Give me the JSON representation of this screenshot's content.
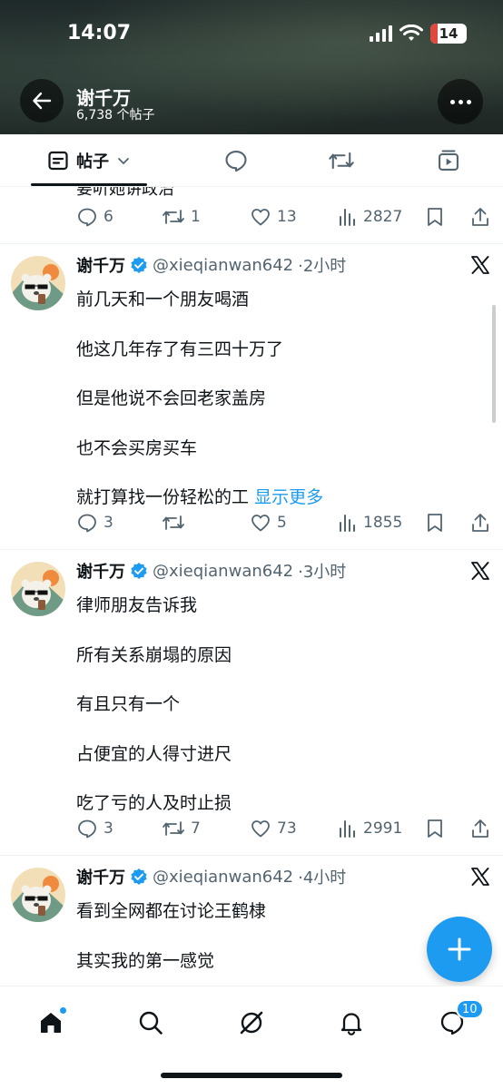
{
  "status_bar": {
    "time": "14:07",
    "battery": "14"
  },
  "header": {
    "title": "谢千万",
    "subtitle": "6,738 个帖子"
  },
  "tabs": {
    "posts_label": "帖子"
  },
  "partial_post": {
    "text": "要听她讲政治",
    "replies": "6",
    "reposts": "1",
    "likes": "13",
    "views": "2827"
  },
  "posts": [
    {
      "name": "谢千万",
      "handle": "@xieqianwan642",
      "time": "·2小时",
      "lines": [
        "前几天和一个朋友喝酒",
        "他这几年存了有三四十万了",
        "但是他说不会回老家盖房",
        "也不会买房买车",
        "就打算找一份轻松的工"
      ],
      "show_more": "显示更多",
      "replies": "3",
      "reposts": "",
      "likes": "5",
      "views": "1855"
    },
    {
      "name": "谢千万",
      "handle": "@xieqianwan642",
      "time": "·3小时",
      "lines": [
        "律师朋友告诉我",
        "所有关系崩塌的原因",
        "有且只有一个",
        "占便宜的人得寸进尺",
        "吃了亏的人及时止损"
      ],
      "replies": "3",
      "reposts": "7",
      "likes": "73",
      "views": "2991"
    },
    {
      "name": "谢千万",
      "handle": "@xieqianwan642",
      "time": "·4小时",
      "lines": [
        "看到全网都在讨论王鹤棣",
        "其实我的第一感觉"
      ]
    }
  ],
  "bottom_nav": {
    "messages_badge": "10"
  },
  "colors": {
    "accent": "#1d9bf0",
    "text": "#0f1419",
    "muted": "#536471"
  }
}
